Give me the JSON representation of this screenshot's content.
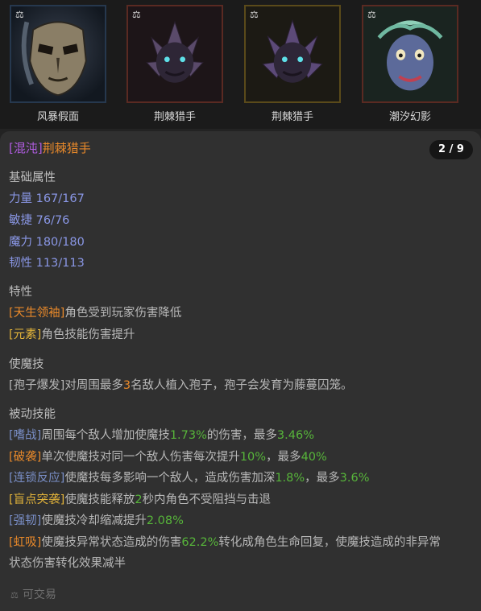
{
  "cards": [
    {
      "name": "风暴假面",
      "border": "#26384e"
    },
    {
      "name": "荆棘猎手",
      "border": "#5a2a22"
    },
    {
      "name": "荆棘猎手",
      "border": "#5a4a1a"
    },
    {
      "name": "潮汐幻影",
      "border": "#5a2a22"
    }
  ],
  "item": {
    "prefix": "[混沌]",
    "name": "荆棘猎手",
    "counter": "2 / 9"
  },
  "base_attrs": {
    "heading": "基础属性",
    "rows": [
      {
        "label": "力量",
        "value": "167/167"
      },
      {
        "label": "敏捷",
        "value": "76/76"
      },
      {
        "label": "魔力",
        "value": "180/180"
      },
      {
        "label": "韧性",
        "value": "113/113"
      }
    ]
  },
  "traits": {
    "heading": "特性",
    "rows": [
      {
        "tag": "[天生领袖]",
        "text": "角色受到玩家伤害降低"
      },
      {
        "tag": "[元素]",
        "text": "角色技能伤害提升"
      }
    ]
  },
  "skill": {
    "heading": "使魔技",
    "tag": "[孢子爆发]",
    "t1": "对周围最多",
    "n1": "3",
    "t2": "名敌人植入孢子，孢子会发育为藤蔓囚笼。"
  },
  "passives": {
    "heading": "被动技能",
    "p1": {
      "tag": "[嗜战]",
      "t1": "周围每个敌人增加使魔技",
      "v1": "1.73%",
      "t2": "的伤害，最多",
      "v2": "3.46%"
    },
    "p2": {
      "tag": "[破袭]",
      "t1": "单次使魔技对同一个敌人伤害每次提升",
      "v1": "10%",
      "t2": "，最多",
      "v2": "40%"
    },
    "p3": {
      "tag": "[连锁反应]",
      "t1": "使魔技每多影响一个敌人，造成伤害加深",
      "v1": "1.8%",
      "t2": "，最多",
      "v2": "3.6%"
    },
    "p4": {
      "tag": "[盲点突袭]",
      "t1": "使魔技能释放",
      "v1": "2",
      "t2": "秒内角色不受阻挡与击退"
    },
    "p5": {
      "tag": "[强韧]",
      "t1": "使魔技冷却缩减提升",
      "v1": "2.08%"
    },
    "p6": {
      "tag": "[虹吸]",
      "t1": "使魔技异常状态造成的伤害",
      "v1": "62.2%",
      "t2": "转化成角色生命回复，使魔技造成的非异常",
      "t3": "状态伤害转化效果减半"
    }
  },
  "footer": {
    "icon": "scale-icon",
    "text": "可交易"
  },
  "colors": {
    "purple": "#b05ce0",
    "orange": "#e8892a",
    "stat_blue": "#8a97e6",
    "yellow": "#e2b33a",
    "tag_blue": "#7a8fc8",
    "green": "#57b53a"
  }
}
